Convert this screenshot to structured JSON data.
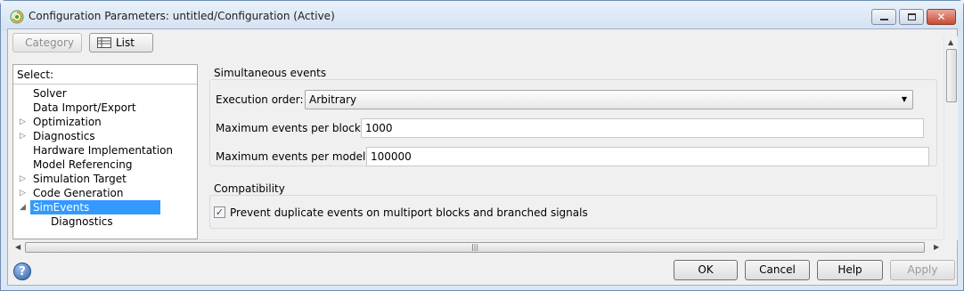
{
  "window": {
    "title": "Configuration Parameters: untitled/Configuration (Active)",
    "minimize_icon": "minimize-icon",
    "maximize_icon": "maximize-icon",
    "close_icon": "close-icon"
  },
  "toolbar": {
    "category_label": "Category",
    "list_label": "List"
  },
  "tree": {
    "header": "Select:",
    "items": [
      {
        "label": "Solver",
        "expander": ""
      },
      {
        "label": "Data Import/Export",
        "expander": ""
      },
      {
        "label": "Optimization",
        "expander": "▷"
      },
      {
        "label": "Diagnostics",
        "expander": "▷"
      },
      {
        "label": "Hardware Implementation",
        "expander": ""
      },
      {
        "label": "Model Referencing",
        "expander": ""
      },
      {
        "label": "Simulation Target",
        "expander": "▷"
      },
      {
        "label": "Code Generation",
        "expander": "▷"
      },
      {
        "label": "SimEvents",
        "expander": "◢",
        "selected": true
      },
      {
        "label": "Diagnostics",
        "expander": "",
        "child": true
      }
    ]
  },
  "simultaneous_events": {
    "group_title": "Simultaneous events",
    "execution_order_label": "Execution order:",
    "execution_order_value": "Arbitrary",
    "max_events_block_label": "Maximum events per block:",
    "max_events_block_value": "1000",
    "max_events_model_label": "Maximum events per model:",
    "max_events_model_value": "100000"
  },
  "compatibility": {
    "group_title": "Compatibility",
    "prevent_duplicate_label": "Prevent duplicate events on multiport blocks and branched signals",
    "prevent_duplicate_checked": "✓"
  },
  "footer": {
    "ok_label": "OK",
    "cancel_label": "Cancel",
    "help_label": "Help",
    "apply_label": "Apply",
    "help_icon_glyph": "?"
  },
  "colors": {
    "selection": "#3399ff",
    "titlebar": "#dbe7f4"
  }
}
